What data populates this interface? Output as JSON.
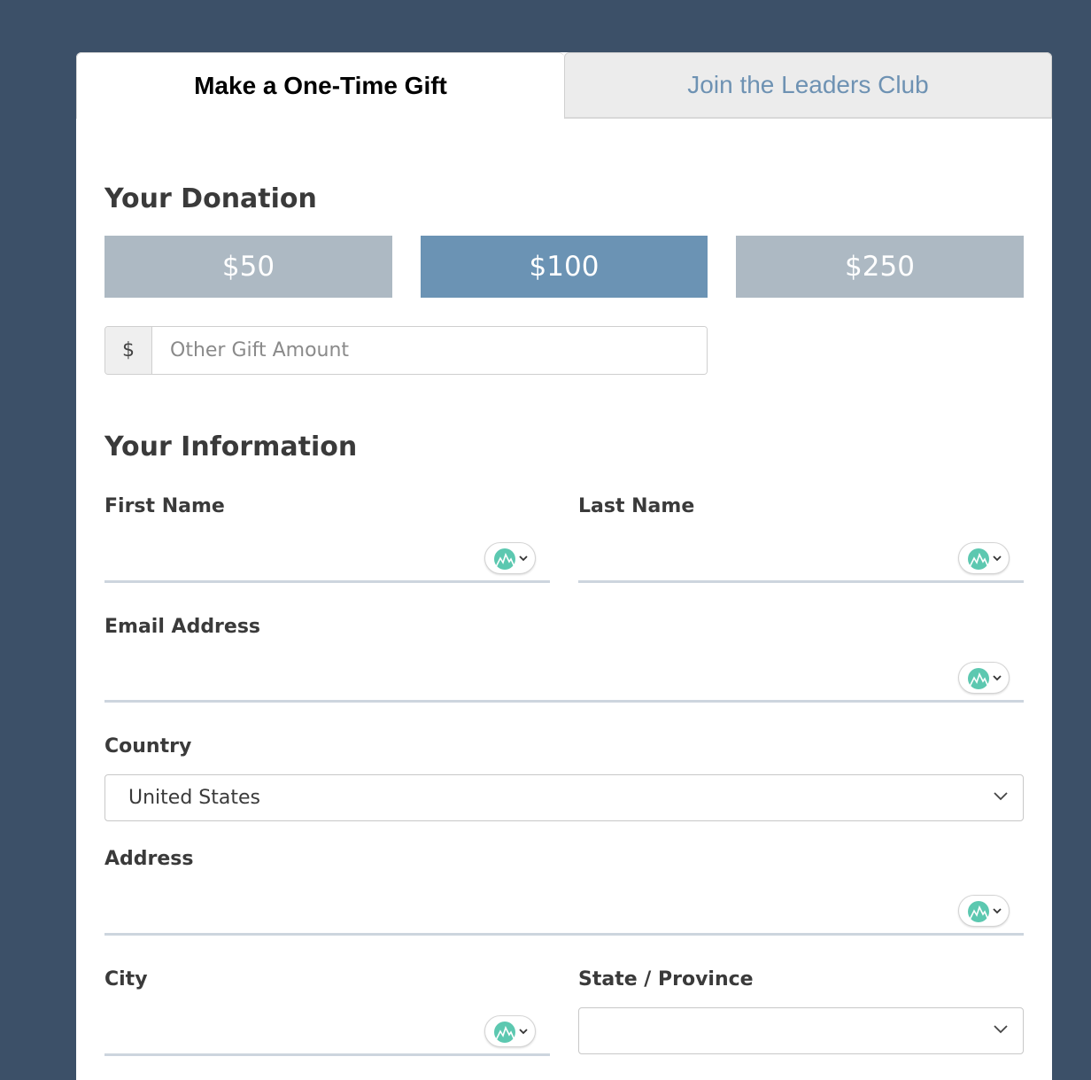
{
  "tabs": {
    "one_time": "Make a One-Time Gift",
    "leaders_club": "Join the Leaders Club"
  },
  "donation": {
    "heading": "Your Donation",
    "amounts": [
      "$50",
      "$100",
      "$250"
    ],
    "selected": "$100",
    "other_prefix": "$",
    "other_placeholder": "Other Gift Amount"
  },
  "info": {
    "heading": "Your Information",
    "first_name_label": "First Name",
    "last_name_label": "Last Name",
    "email_label": "Email Address",
    "country_label": "Country",
    "country_value": "United States",
    "address_label": "Address",
    "city_label": "City",
    "state_label": "State / Province",
    "state_value": ""
  },
  "icons": {
    "autofill": "password-manager-mountain-icon",
    "dropdown": "chevron-down-icon"
  },
  "colors": {
    "background": "#3c5068",
    "amount_selected": "#6b93b4",
    "amount_unselected": "#adb9c3",
    "tab_inactive_text": "#6e92b3",
    "autofill_icon": "#5cc8b0"
  }
}
